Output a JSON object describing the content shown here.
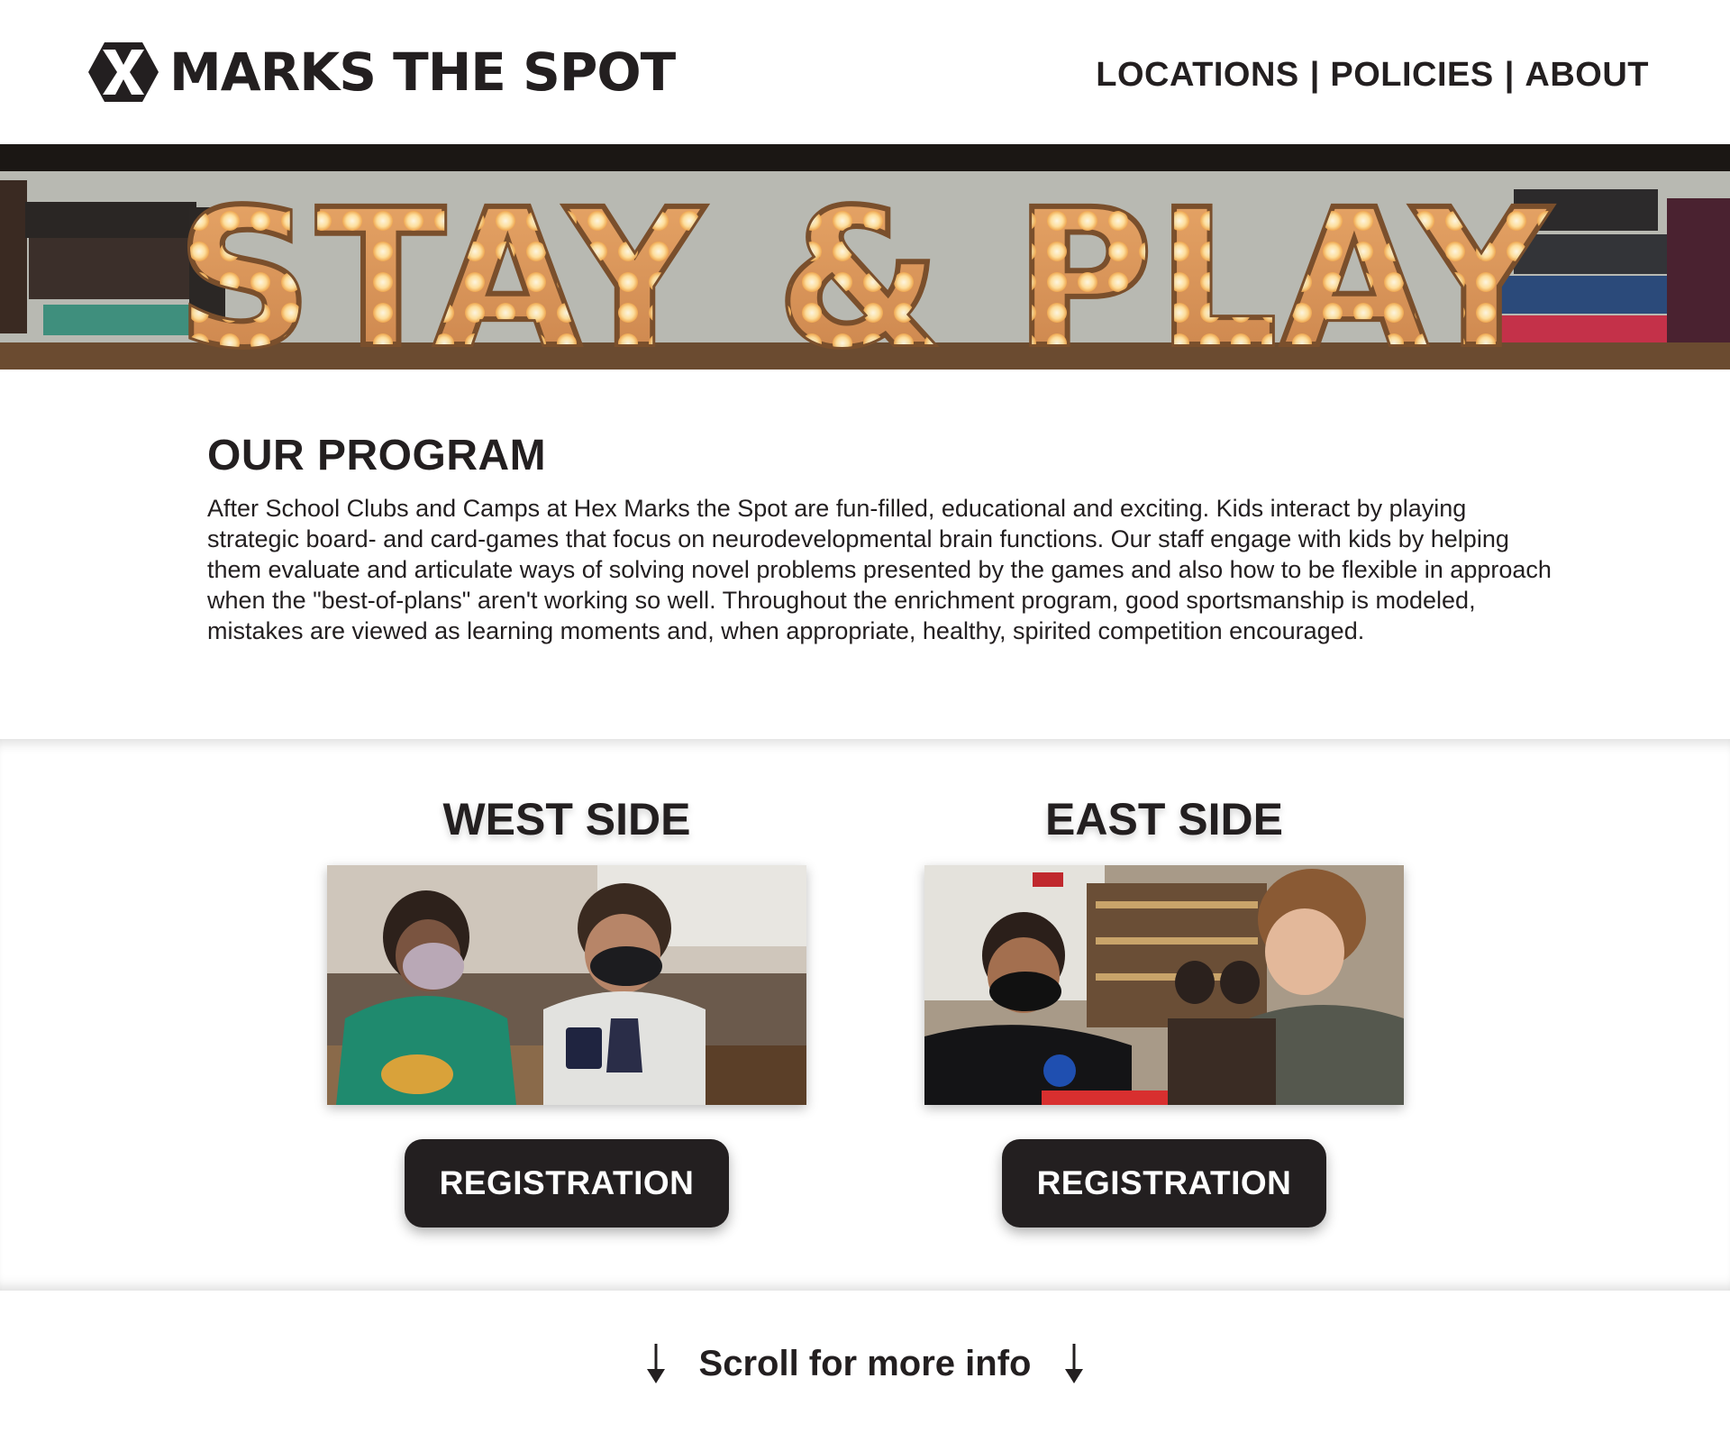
{
  "header": {
    "logo_text": "MARKS THE SPOT",
    "nav": {
      "locations": "LOCATIONS",
      "policies": "POLICIES",
      "about": "ABOUT",
      "separator": "|"
    }
  },
  "hero": {
    "banner_text": "STAY & PLAY"
  },
  "program": {
    "title": "OUR PROGRAM",
    "body": "After School Clubs and Camps at Hex Marks the Spot are fun-filled, educational and exciting. Kids interact by playing strategic board- and card-games that focus on neurodevelopmental brain functions. Our staff engage with kids by helping them evaluate and articulate ways of solving novel problems presented by the games and also how to be flexible in approach when the \"best-of-plans\" aren't working so well. Throughout the enrichment program, good sportsmanship is modeled, mistakes are viewed as learning moments and, when appropriate, healthy, spirited competition encouraged."
  },
  "locations": {
    "west": {
      "title": "WEST SIDE",
      "button": "REGISTRATION"
    },
    "east": {
      "title": "EAST SIDE",
      "button": "REGISTRATION"
    }
  },
  "scroll_hint": {
    "text": "Scroll for more info"
  },
  "icons": {
    "logo": "hex-x-logo-icon",
    "down_arrow": "arrow-down-icon"
  },
  "colors": {
    "text": "#231f20",
    "button_bg": "#231f20",
    "button_text": "#ffffff",
    "bulb": "#ffe2a0",
    "letter": "#d99a5a"
  }
}
